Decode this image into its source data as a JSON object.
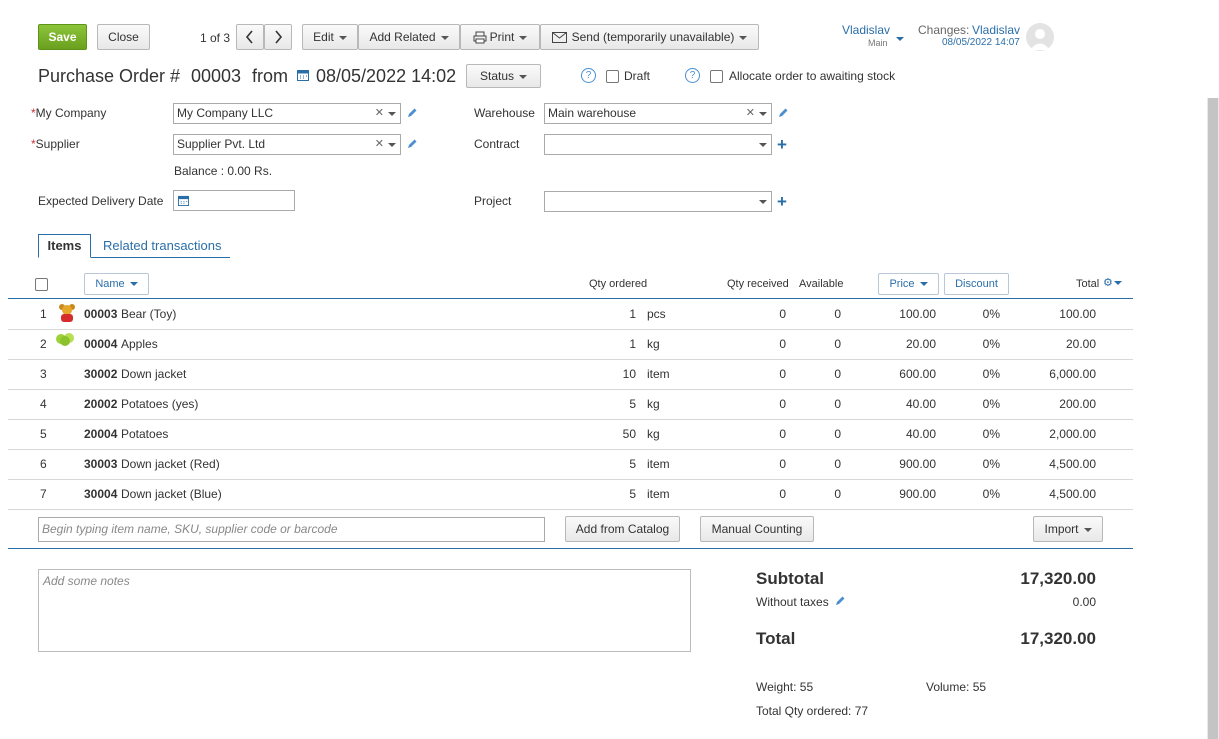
{
  "toolbar": {
    "save_label": "Save",
    "close_label": "Close",
    "pager": "1 of 3",
    "edit_label": "Edit",
    "add_related_label": "Add Related",
    "print_label": "Print",
    "send_label": "Send (temporarily unavailable)",
    "user_name": "Vladislav",
    "user_sub": "Main",
    "changes_label": "Changes:",
    "changes_user": "Vladislav",
    "changes_date": "08/05/2022 14:07"
  },
  "header": {
    "title_prefix": "Purchase Order #",
    "order_number": "00003",
    "from_label": "from",
    "date": "08/05/2022 14:02",
    "status_label": "Status",
    "draft_label": "Draft",
    "allocate_label": "Allocate order to awaiting stock"
  },
  "form": {
    "my_company_label": "My Company",
    "my_company_value": "My Company LLC",
    "supplier_label": "Supplier",
    "supplier_value": "Supplier Pvt. Ltd",
    "balance_text": "Balance : 0.00 Rs.",
    "expected_delivery_label": "Expected Delivery Date",
    "warehouse_label": "Warehouse",
    "warehouse_value": "Main warehouse",
    "contract_label": "Contract",
    "contract_value": "",
    "project_label": "Project",
    "project_value": ""
  },
  "tabs": [
    {
      "label": "Items"
    },
    {
      "label": "Related transactions"
    }
  ],
  "table": {
    "columns": {
      "name": "Name",
      "qty_ordered": "Qty ordered",
      "qty_received": "Qty received",
      "available": "Available",
      "price": "Price",
      "discount": "Discount",
      "total": "Total"
    },
    "rows": [
      {
        "num": "1",
        "sku": "00003",
        "name": "Bear (Toy)",
        "qty": "1",
        "unit": "pcs",
        "received": "0",
        "available": "0",
        "price": "100.00",
        "discount": "0%",
        "total": "100.00",
        "thumb": "bear"
      },
      {
        "num": "2",
        "sku": "00004",
        "name": "Apples",
        "qty": "1",
        "unit": "kg",
        "received": "0",
        "available": "0",
        "price": "20.00",
        "discount": "0%",
        "total": "20.00",
        "thumb": "apples"
      },
      {
        "num": "3",
        "sku": "30002",
        "name": "Down jacket",
        "qty": "10",
        "unit": "item",
        "received": "0",
        "available": "0",
        "price": "600.00",
        "discount": "0%",
        "total": "6,000.00",
        "thumb": ""
      },
      {
        "num": "4",
        "sku": "20002",
        "name": "Potatoes (yes)",
        "qty": "5",
        "unit": "kg",
        "received": "0",
        "available": "0",
        "price": "40.00",
        "discount": "0%",
        "total": "200.00",
        "thumb": ""
      },
      {
        "num": "5",
        "sku": "20004",
        "name": "Potatoes",
        "qty": "50",
        "unit": "kg",
        "received": "0",
        "available": "0",
        "price": "40.00",
        "discount": "0%",
        "total": "2,000.00",
        "thumb": ""
      },
      {
        "num": "6",
        "sku": "30003",
        "name": "Down jacket (Red)",
        "qty": "5",
        "unit": "item",
        "received": "0",
        "available": "0",
        "price": "900.00",
        "discount": "0%",
        "total": "4,500.00",
        "thumb": ""
      },
      {
        "num": "7",
        "sku": "30004",
        "name": "Down jacket (Blue)",
        "qty": "5",
        "unit": "item",
        "received": "0",
        "available": "0",
        "price": "900.00",
        "discount": "0%",
        "total": "4,500.00",
        "thumb": ""
      }
    ],
    "search_placeholder": "Begin typing item name, SKU, supplier code or barcode",
    "add_from_catalog_label": "Add from Catalog",
    "manual_counting_label": "Manual Counting",
    "import_label": "Import"
  },
  "notes": {
    "placeholder": "Add some notes"
  },
  "summary": {
    "subtotal_label": "Subtotal",
    "subtotal_value": "17,320.00",
    "taxes_label": "Without taxes",
    "taxes_value": "0.00",
    "total_label": "Total",
    "total_value": "17,320.00",
    "weight_text": "Weight: 55",
    "volume_text": "Volume: 55",
    "total_qty_text": "Total Qty ordered: 77"
  }
}
